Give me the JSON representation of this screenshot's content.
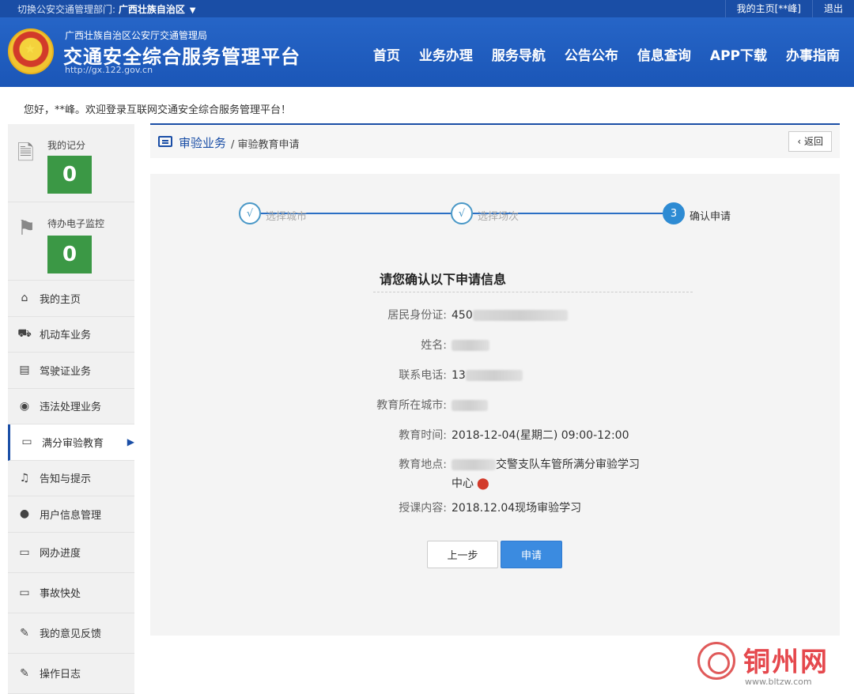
{
  "topbar": {
    "dept_prefix": "切换公安交通管理部门:",
    "dept_name": "广西壮族自治区",
    "caret": "▼",
    "my_home": "我的主页[**峰]",
    "logout": "退出"
  },
  "header": {
    "subtitle": "广西壮族自治区公安厅交通管理局",
    "title": "交通安全综合服务管理平台",
    "url": "http://gx.122.gov.cn",
    "nav": [
      "首页",
      "业务办理",
      "服务导航",
      "公告公布",
      "信息查询",
      "APP下载",
      "办事指南"
    ]
  },
  "welcome": "您好，**峰。欢迎登录互联网交通安全综合服务管理平台！",
  "sidebar": {
    "score_label": "我的记分",
    "score_value": "0",
    "monitor_label": "待办电子监控",
    "monitor_value": "0",
    "items": [
      {
        "label": "我的主页",
        "icon": "home-icon",
        "glyph": "⌂"
      },
      {
        "label": "机动车业务",
        "icon": "truck-icon",
        "glyph": "⛟"
      },
      {
        "label": "驾驶证业务",
        "icon": "license-card-icon",
        "glyph": "▤"
      },
      {
        "label": "违法处理业务",
        "icon": "camera-icon",
        "glyph": "◉"
      },
      {
        "label": "满分审验教育",
        "icon": "monitor-icon",
        "glyph": "▭"
      },
      {
        "label": "告知与提示",
        "icon": "bell-icon",
        "glyph": "♫"
      },
      {
        "label": "用户信息管理",
        "icon": "user-icon",
        "glyph": "●"
      },
      {
        "label": "网办进度",
        "icon": "progress-icon",
        "glyph": "▭"
      },
      {
        "label": "事故快处",
        "icon": "accident-icon",
        "glyph": "▭"
      },
      {
        "label": "我的意见反馈",
        "icon": "feedback-icon",
        "glyph": "✎"
      },
      {
        "label": "操作日志",
        "icon": "log-icon",
        "glyph": "✎"
      }
    ],
    "active_index": 4,
    "active_arrow": "▶"
  },
  "breadcrumb": {
    "section": "审验业务",
    "page": "/ 审验教育申请",
    "back": "‹ 返回"
  },
  "steps": [
    {
      "mark": "√",
      "label": "选择城市"
    },
    {
      "mark": "√",
      "label": "选择场次"
    },
    {
      "mark": "3",
      "label": "确认申请"
    }
  ],
  "confirm": {
    "title": "请您确认以下申请信息",
    "id_label": "居民身份证:",
    "id_value": "450",
    "name_label": "姓名:",
    "phone_label": "联系电话:",
    "phone_value": "13",
    "city_label": "教育所在城市:",
    "time_label": "教育时间:",
    "time_value": "2018-12-04(星期二) 09:00-12:00",
    "place_label": "教育地点:",
    "place_value_1": "交警支队车管所满分审验学习",
    "place_value_2": "中心",
    "content_label": "授课内容:",
    "content_value": "2018.12.04现场审验学习"
  },
  "buttons": {
    "prev": "上一步",
    "apply": "申请"
  },
  "watermark": {
    "name": "铜州网",
    "url": "www.bltzw.com"
  }
}
